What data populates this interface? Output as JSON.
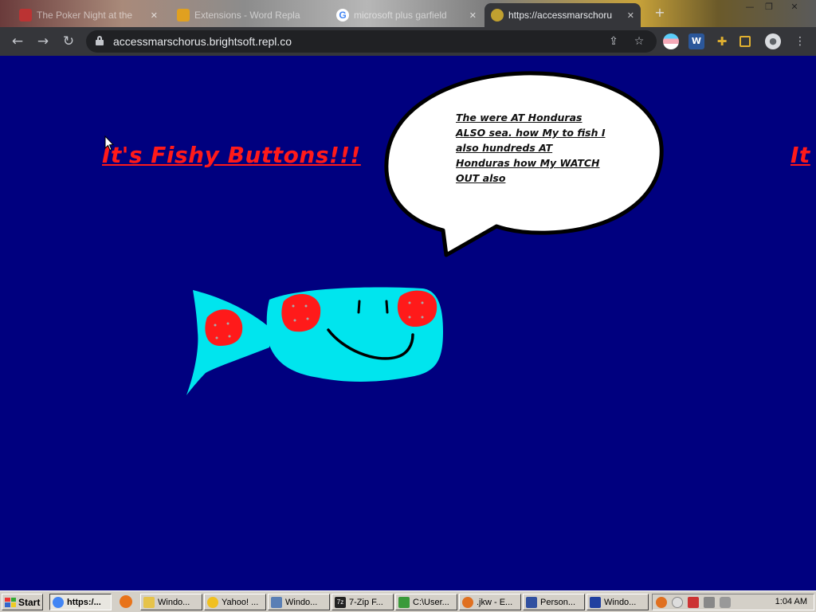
{
  "browser": {
    "tabs": [
      {
        "title": "The Poker Night at the",
        "favicon_color": "#b33"
      },
      {
        "title": "Extensions - Word Repla",
        "favicon_color": "#e0a020"
      },
      {
        "title": "microsoft plus garfield",
        "favicon_color": "#4285f4"
      },
      {
        "title": "https://accessmarschoru",
        "favicon_color": "#c0a030"
      }
    ],
    "url": "accessmarschorus.brightsoft.repl.co"
  },
  "page": {
    "heading": "It's Fishy Buttons!!!",
    "heading_repeat": "It",
    "speech": "The were AT Honduras ALSO sea. how My to fish I also hundreds AT Honduras how My WATCH OUT also"
  },
  "taskbar": {
    "start_label": "Start",
    "buttons": [
      {
        "label": "https:/...",
        "color": "#4285f4"
      },
      {
        "label": "Windo...",
        "color": "#e6c34a"
      },
      {
        "label": "Yahoo! ...",
        "color": "#f0c020"
      },
      {
        "label": "Windo...",
        "color": "#5a7fb5"
      },
      {
        "label": "7-Zip F...",
        "color": "#222"
      },
      {
        "label": "C:\\User...",
        "color": "#3a9a3a"
      },
      {
        "label": ".jkw - E...",
        "color": "#e07020"
      },
      {
        "label": "Person...",
        "color": "#3050a0"
      },
      {
        "label": "Windo...",
        "color": "#2040a0"
      }
    ],
    "clock": "1:04 AM"
  }
}
